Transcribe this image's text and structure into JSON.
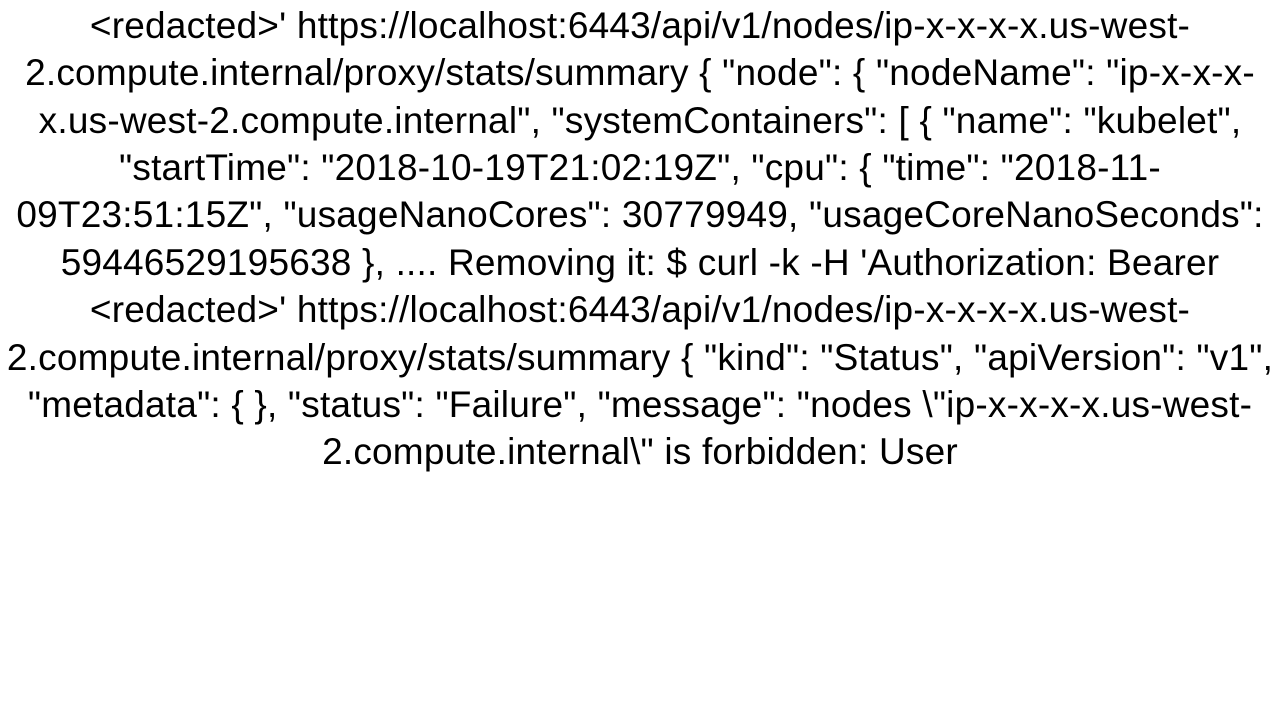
{
  "body": {
    "content": "<redacted>' https://localhost:6443/api/v1/nodes/ip-x-x-x-x.us-west-2.compute.internal/proxy/stats/summary {   \"node\": {    \"nodeName\": \"ip-x-x-x-x.us-west-2.compute.internal\",    \"systemContainers\": [     {      \"name\": \"kubelet\",      \"startTime\": \"2018-10-19T21:02:19Z\",      \"cpu\": {       \"time\": \"2018-11-09T23:51:15Z\",       \"usageNanoCores\": 30779949,       \"usageCoreNanoSeconds\": 59446529195638      }, ....   Removing it: $ curl -k -H 'Authorization: Bearer <redacted>' https://localhost:6443/api/v1/nodes/ip-x-x-x-x.us-west-2.compute.internal/proxy/stats/summary {   \"kind\": \"Status\",   \"apiVersion\": \"v1\",   \"metadata\": {    },   \"status\": \"Failure\",   \"message\": \"nodes \\\"ip-x-x-x-x.us-west-2.compute.internal\\\" is forbidden: User"
  }
}
